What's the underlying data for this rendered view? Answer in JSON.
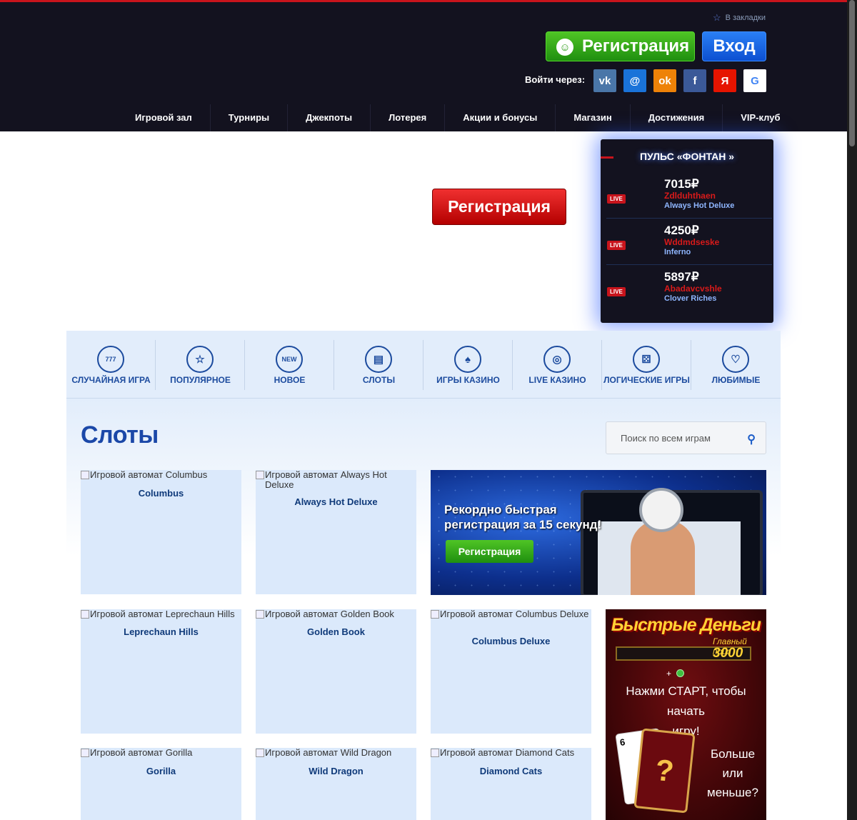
{
  "header": {
    "bookmark_label": "В закладки",
    "register_label": "Регистрация",
    "login_label": "Вход",
    "login_via_label": "Войти через:",
    "socials": [
      {
        "icon": "vk-icon",
        "glyph": "vk",
        "color": "#4a76a8"
      },
      {
        "icon": "mailru-icon",
        "glyph": "@",
        "color": "#1a73d9"
      },
      {
        "icon": "odnoklassniki-icon",
        "glyph": "ok",
        "color": "#ee8208"
      },
      {
        "icon": "facebook-icon",
        "glyph": "f",
        "color": "#3b5998"
      },
      {
        "icon": "yandex-icon",
        "glyph": "Я",
        "color": "#e61400"
      },
      {
        "icon": "google-icon",
        "glyph": "G",
        "color": "#ffffff"
      }
    ],
    "nav": [
      "Игровой зал",
      "Турниры",
      "Джекпоты",
      "Лотерея",
      "Акции и бонусы",
      "Магазин",
      "Достижения",
      "VIP-клуб"
    ]
  },
  "hero": {
    "register_label": "Регистрация"
  },
  "pulse": {
    "title": "ПУЛЬС «ФОНТАН »",
    "live_label": "LIVE",
    "wins": [
      {
        "amount": "7015₽",
        "user": "Zdlduhthaen",
        "game": "Always Hot Deluxe"
      },
      {
        "amount": "4250₽",
        "user": "Wddmdseske",
        "game": "Inferno"
      },
      {
        "amount": "5897₽",
        "user": "Abadavcvshle",
        "game": "Clover Riches"
      }
    ]
  },
  "categories": [
    {
      "label": "СЛУЧАЙНАЯ ИГРА",
      "icon": "777-icon",
      "glyph": "777"
    },
    {
      "label": "ПОПУЛЯРНОЕ",
      "icon": "star-icon",
      "glyph": "☆"
    },
    {
      "label": "НОВОЕ",
      "icon": "new-icon",
      "glyph": "NEW"
    },
    {
      "label": "СЛОТЫ",
      "icon": "slot-machine-icon",
      "glyph": "▤"
    },
    {
      "label": "ИГРЫ КАЗИНО",
      "icon": "cards-icon",
      "glyph": "♠"
    },
    {
      "label": "LIVE КАЗИНО",
      "icon": "roulette-icon",
      "glyph": "◎"
    },
    {
      "label": "ЛОГИЧЕСКИЕ ИГРЫ",
      "icon": "dice-icon",
      "glyph": "⚄"
    },
    {
      "label": "ЛЮБИМЫЕ",
      "icon": "heart-icon",
      "glyph": "♡"
    }
  ],
  "main": {
    "title": "Слоты",
    "search_placeholder": "Поиск по всем играм"
  },
  "games": [
    {
      "alt": "Игровой автомат Columbus",
      "name": "Columbus"
    },
    {
      "alt": "Игровой автомат Always Hot Deluxe",
      "name": "Always Hot Deluxe"
    },
    {
      "alt": "Игровой автомат Leprechaun Hills",
      "name": "Leprechaun Hills"
    },
    {
      "alt": "Игровой автомат Golden Book",
      "name": "Golden Book"
    },
    {
      "alt": "Игровой автомат Columbus Deluxe",
      "name": "Columbus Deluxe"
    },
    {
      "alt": "Игровой автомат Gorilla",
      "name": "Gorilla"
    },
    {
      "alt": "Игровой автомат Wild Dragon",
      "name": "Wild Dragon"
    },
    {
      "alt": "Игровой автомат Diamond Cats",
      "name": "Diamond Cats"
    }
  ],
  "banner": {
    "line1": "Рекордно быстрая",
    "line2": "регистрация за 15 секунд!",
    "cta": "Регистрация"
  },
  "promo": {
    "title": "Быстрые Деньги",
    "prize_label": "Главный приз",
    "prize_value": "3000",
    "plus": "+",
    "press_line1": "Нажми СТАРТ, чтобы начать",
    "press_line2": "игру!",
    "card_value": "6",
    "card_back": "?",
    "more_line1": "Больше",
    "more_line2": "или",
    "more_line3": "меньше?"
  },
  "colors": {
    "header_bg": "#13121f",
    "accent_red": "#c8141c",
    "brand_blue": "#1b48a8",
    "green": "#2a9b14"
  }
}
